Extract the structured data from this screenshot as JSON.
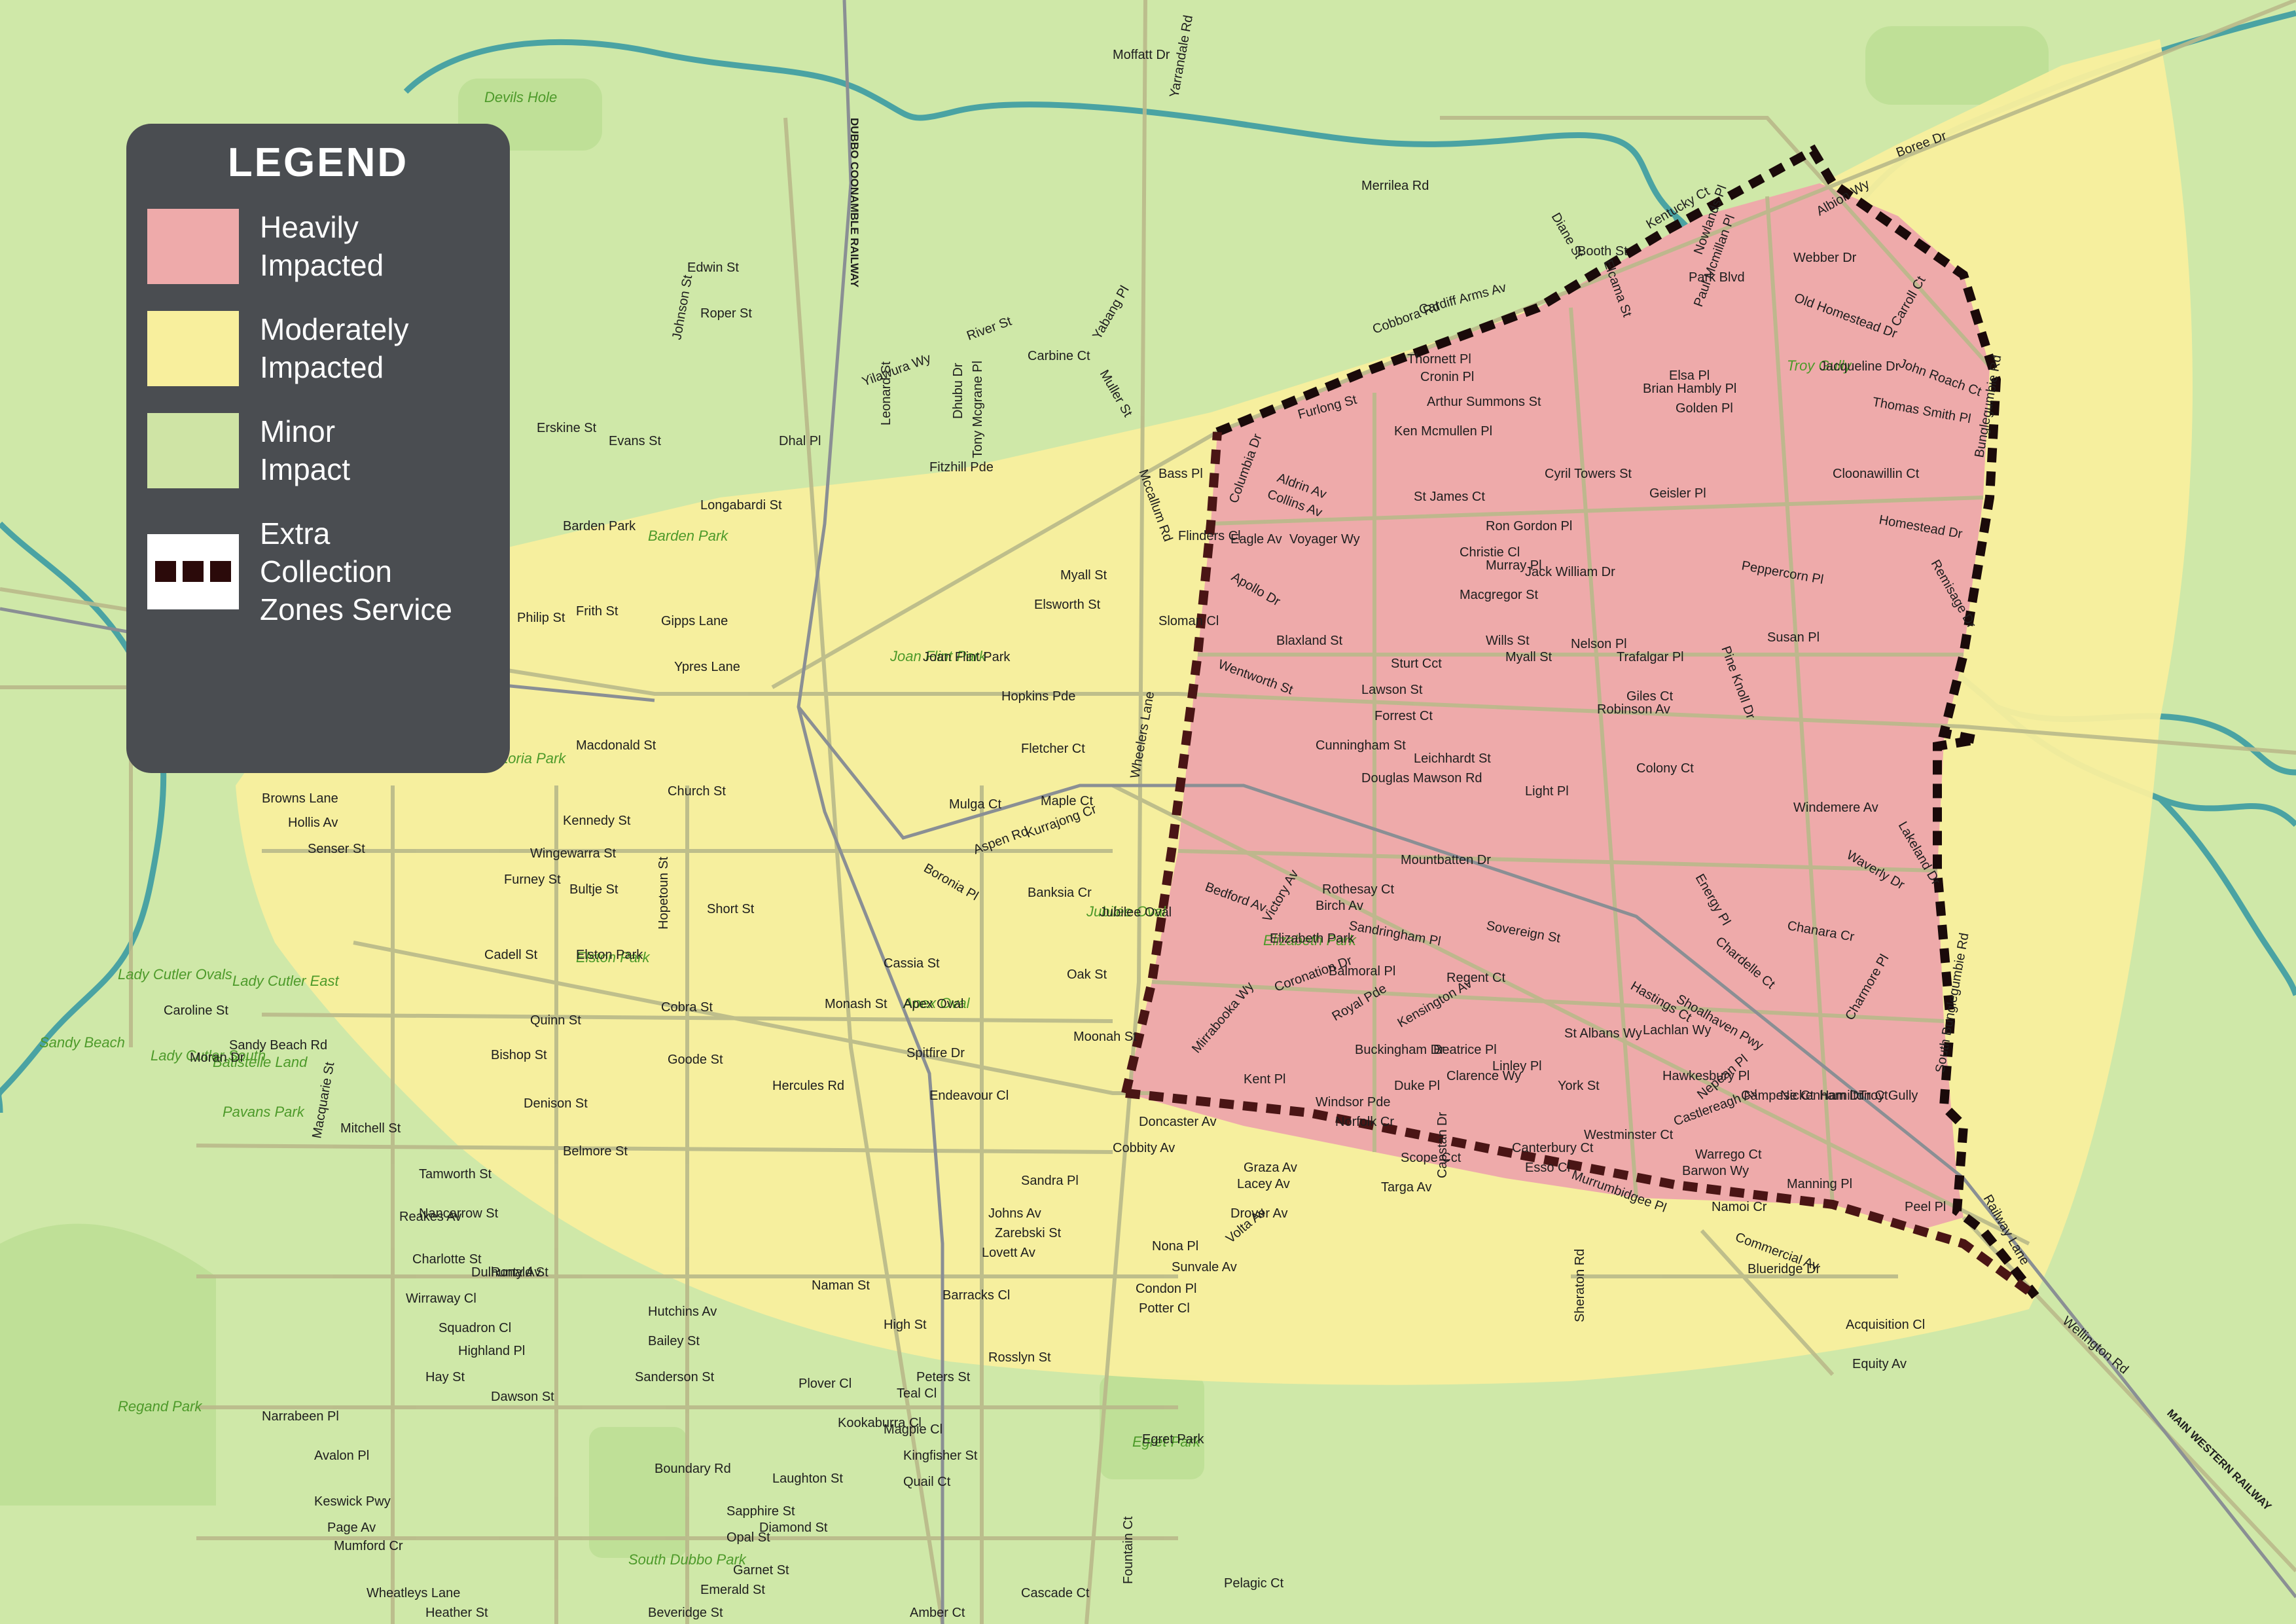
{
  "legend": {
    "title": "LEGEND",
    "items": [
      {
        "label": "Heavily\nImpacted",
        "color": "#eeaaaa"
      },
      {
        "label": "Moderately\nImpacted",
        "color": "#f8ef9d"
      },
      {
        "label": "Minor\nImpact",
        "color": "#cfe4a5"
      },
      {
        "label": "Extra\nCollection\nZones Service",
        "color": "#2b0a0a"
      }
    ]
  },
  "colors": {
    "background": "#cfe8a8",
    "heavy": "#eeaaaa",
    "moderate": "#f8ef9d",
    "minor": "#cfe4a5",
    "boundary": "#1a0a0a",
    "river": "#4aa3a3",
    "roads": "#b9b98a"
  },
  "streets": [
    {
      "text": "Moffatt Dr"
    },
    {
      "text": "Yarrandale Rd"
    },
    {
      "text": "Merrilea Rd"
    },
    {
      "text": "Boree Dr"
    },
    {
      "text": "Kentucky Ct"
    },
    {
      "text": "Albion Wy"
    },
    {
      "text": "Webber Dr"
    },
    {
      "text": "Old Homestead Dr"
    },
    {
      "text": "Carroll Ct"
    },
    {
      "text": "John Roach Ct"
    },
    {
      "text": "Thomas Smith Pl"
    },
    {
      "text": "Bunglegumbie Rd"
    },
    {
      "text": "Cloonawillin Ct"
    },
    {
      "text": "Homestead Dr"
    },
    {
      "text": "Remisage Dr"
    },
    {
      "text": "Peppercorn Pl"
    },
    {
      "text": "Susan Pl"
    },
    {
      "text": "Pine Knoll Dr"
    },
    {
      "text": "Trafalgar Pl"
    },
    {
      "text": "Myall St"
    },
    {
      "text": "Colony Ct"
    },
    {
      "text": "Windemere Av"
    },
    {
      "text": "Waverly Dr"
    },
    {
      "text": "Lakeland Dr"
    },
    {
      "text": "Chanara Cr"
    },
    {
      "text": "Chardelle Ct"
    },
    {
      "text": "Charmore Pl"
    },
    {
      "text": "South Bunglegumbie Rd"
    },
    {
      "text": "Cobbora Rd"
    },
    {
      "text": "Cardiff Arms Av"
    },
    {
      "text": "Thornett Pl"
    },
    {
      "text": "Cronin Pl"
    },
    {
      "text": "Arthur Summons St"
    },
    {
      "text": "Ken Mcmullen Pl"
    },
    {
      "text": "Furlong St"
    },
    {
      "text": "Aldrin Av"
    },
    {
      "text": "Collins Av"
    },
    {
      "text": "Columbia Dr"
    },
    {
      "text": "Voyager Wy"
    },
    {
      "text": "Eagle Av"
    },
    {
      "text": "Apollo Dr"
    },
    {
      "text": "St James Ct"
    },
    {
      "text": "Ron Gordon Pl"
    },
    {
      "text": "Macgregor St"
    },
    {
      "text": "Wills St"
    },
    {
      "text": "Nelson Pl"
    },
    {
      "text": "Blaxland St"
    },
    {
      "text": "Sturt Cct"
    },
    {
      "text": "Wentworth St"
    },
    {
      "text": "Lawson St"
    },
    {
      "text": "Forrest Ct"
    },
    {
      "text": "Cunningham St"
    },
    {
      "text": "Leichhardt St"
    },
    {
      "text": "Giles Ct"
    },
    {
      "text": "Robinson Av"
    },
    {
      "text": "Douglas Mawson Rd"
    },
    {
      "text": "Light Pl"
    },
    {
      "text": "Mountbatten Dr"
    },
    {
      "text": "Bedford Av"
    },
    {
      "text": "Victory Av"
    },
    {
      "text": "Rothesay Ct"
    },
    {
      "text": "Birch Av"
    },
    {
      "text": "Sandringham Pl"
    },
    {
      "text": "Sovereign St"
    },
    {
      "text": "Balmoral Pl"
    },
    {
      "text": "Regent Ct"
    },
    {
      "text": "Coronation Dr"
    },
    {
      "text": "Royal Pde"
    },
    {
      "text": "Buckingham Dr"
    },
    {
      "text": "Kensington Av"
    },
    {
      "text": "Windsor Pde"
    },
    {
      "text": "Duke Pl"
    },
    {
      "text": "Clarence Wy"
    },
    {
      "text": "St Albans Wy"
    },
    {
      "text": "Linley Pl"
    },
    {
      "text": "York St"
    },
    {
      "text": "Hastings Ct"
    },
    {
      "text": "Lachlan Wy"
    },
    {
      "text": "Hawkesbury Pl"
    },
    {
      "text": "Nepean Pl"
    },
    {
      "text": "Castlereagh Av"
    },
    {
      "text": "Warrego Ct"
    },
    {
      "text": "Barwon Wy"
    },
    {
      "text": "Westminster Ct"
    },
    {
      "text": "Murrumbidgee Pl"
    },
    {
      "text": "Namoi Cr"
    },
    {
      "text": "Manning Pl"
    },
    {
      "text": "Peel Pl"
    },
    {
      "text": "Canterbury Ct"
    },
    {
      "text": "Kent Pl"
    },
    {
      "text": "Norfolk Cr"
    },
    {
      "text": "Beatrice Pl"
    },
    {
      "text": "Mirrabooka Wy"
    },
    {
      "text": "Elizabeth Park"
    },
    {
      "text": "Energy Pl"
    },
    {
      "text": "Shoalhaven Pwy"
    },
    {
      "text": "Sloman Cl"
    },
    {
      "text": "Bass Pl"
    },
    {
      "text": "Flinders Cl"
    },
    {
      "text": "Wheelers Lane"
    },
    {
      "text": "Jubilee Oval"
    },
    {
      "text": "Oak St"
    },
    {
      "text": "Moonah St"
    },
    {
      "text": "Spitfire Dr"
    },
    {
      "text": "Endeavour Cl"
    },
    {
      "text": "Hercules Rd"
    },
    {
      "text": "Goode St"
    },
    {
      "text": "Cobra St"
    },
    {
      "text": "Quinn St"
    },
    {
      "text": "Bishop St"
    },
    {
      "text": "Denison St"
    },
    {
      "text": "Belmore St"
    },
    {
      "text": "Macquarie St"
    },
    {
      "text": "Cadell St"
    },
    {
      "text": "Tamworth St"
    },
    {
      "text": "Nancarrow St"
    },
    {
      "text": "Hutchins Av"
    },
    {
      "text": "Bailey St"
    },
    {
      "text": "Sanderson St"
    },
    {
      "text": "Hay St"
    },
    {
      "text": "Dawson St"
    },
    {
      "text": "Narrabeen Pl"
    },
    {
      "text": "Boundary Rd"
    },
    {
      "text": "Laughton St"
    },
    {
      "text": "Sapphire St"
    },
    {
      "text": "Diamond St"
    },
    {
      "text": "Opal St"
    },
    {
      "text": "Garnet St"
    },
    {
      "text": "Emerald St"
    },
    {
      "text": "Heather St"
    },
    {
      "text": "Wheatleys Lane"
    },
    {
      "text": "Beveridge St"
    },
    {
      "text": "Amber Ct"
    },
    {
      "text": "Pelagic Ct"
    },
    {
      "text": "Cascade Ct"
    },
    {
      "text": "Fountain Ct"
    },
    {
      "text": "Egret Park"
    },
    {
      "text": "Commercial Av"
    },
    {
      "text": "Blueridge Dr"
    },
    {
      "text": "Acquisition Cl"
    },
    {
      "text": "Equity Av"
    },
    {
      "text": "Wellington Rd"
    },
    {
      "text": "Sheraton Rd"
    },
    {
      "text": "Railway Lane"
    },
    {
      "text": "Graza Av"
    },
    {
      "text": "Lacey Av"
    },
    {
      "text": "Drover Av"
    },
    {
      "text": "Volta Av"
    },
    {
      "text": "Scope Cct"
    },
    {
      "text": "Targa Av"
    },
    {
      "text": "Capstan Dr"
    },
    {
      "text": "Esso Cl"
    },
    {
      "text": "Mulga Ct"
    },
    {
      "text": "Maple Ct"
    },
    {
      "text": "Kurrajong Cr"
    },
    {
      "text": "Banksia Cr"
    },
    {
      "text": "Boronia Pl"
    },
    {
      "text": "Aspen Rd"
    },
    {
      "text": "Cassia St"
    },
    {
      "text": "Monash St"
    },
    {
      "text": "Apex Oval"
    },
    {
      "text": "Elston Park"
    },
    {
      "text": "Hopetoun St"
    },
    {
      "text": "Short St"
    },
    {
      "text": "Kennedy St"
    },
    {
      "text": "Wingewarra St"
    },
    {
      "text": "Furney St"
    },
    {
      "text": "Bultje St"
    },
    {
      "text": "Macdonald St"
    },
    {
      "text": "Church St"
    },
    {
      "text": "Browns Lane"
    },
    {
      "text": "Hollis Av"
    },
    {
      "text": "Senser St"
    },
    {
      "text": "Joan Flint Park"
    },
    {
      "text": "Fletcher Ct"
    },
    {
      "text": "Hopkins Pde"
    },
    {
      "text": "Elsworth St"
    },
    {
      "text": "Myall St"
    },
    {
      "text": "Fitzhill Pde"
    },
    {
      "text": "Longabardi St"
    },
    {
      "text": "Barden Park"
    },
    {
      "text": "Frith St"
    },
    {
      "text": "Gipps Lane"
    },
    {
      "text": "Ypres Lane"
    },
    {
      "text": "Philip St"
    },
    {
      "text": "Erskine St"
    },
    {
      "text": "Evans St"
    },
    {
      "text": "Edwin St"
    },
    {
      "text": "Roper St"
    },
    {
      "text": "Johnson St"
    },
    {
      "text": "River St"
    },
    {
      "text": "Carbine Ct"
    },
    {
      "text": "Yilawura Wy"
    },
    {
      "text": "Dhal Pl"
    },
    {
      "text": "Yabang Pl"
    },
    {
      "text": "Muller St"
    },
    {
      "text": "Mccallum Rd"
    },
    {
      "text": "Dhubu Dr"
    },
    {
      "text": "Tony Mcgrane Pl"
    },
    {
      "text": "Leonard St"
    },
    {
      "text": "Caroline St"
    },
    {
      "text": "Moran Dr"
    },
    {
      "text": "Sandy Beach Rd"
    },
    {
      "text": "Mitchell St"
    },
    {
      "text": "Reakes Av"
    },
    {
      "text": "Charlotte St"
    },
    {
      "text": "Dulhunty Av"
    },
    {
      "text": "Wirraway Cl"
    },
    {
      "text": "Squadron Cl"
    },
    {
      "text": "Highland Pl"
    },
    {
      "text": "Ronald St"
    },
    {
      "text": "Naman St"
    },
    {
      "text": "Barracks Cl"
    },
    {
      "text": "High St"
    },
    {
      "text": "Rosslyn St"
    },
    {
      "text": "Peters St"
    },
    {
      "text": "Magpie Cl"
    },
    {
      "text": "Kingfisher St"
    },
    {
      "text": "Quail Ct"
    },
    {
      "text": "Kookaburra Cl"
    },
    {
      "text": "Plover Cl"
    },
    {
      "text": "Teal Cl"
    },
    {
      "text": "Zarebski St"
    },
    {
      "text": "Lovett Av"
    },
    {
      "text": "Johns Av"
    },
    {
      "text": "Sandra Pl"
    },
    {
      "text": "Condon Pl"
    },
    {
      "text": "Potter Cl"
    },
    {
      "text": "Nona Pl"
    },
    {
      "text": "Sunvale Av"
    },
    {
      "text": "Cobbity Av"
    },
    {
      "text": "Doncaster Av"
    },
    {
      "text": "Keswick Pwy"
    },
    {
      "text": "Page Av"
    },
    {
      "text": "Mumford Cr"
    },
    {
      "text": "Avalon Pl"
    },
    {
      "text": "Diane St"
    },
    {
      "text": "Booth St"
    },
    {
      "text": "Elcama St"
    },
    {
      "text": "Park Blvd"
    },
    {
      "text": "Paul Mcmillan Pl"
    },
    {
      "text": "Nowlands Pl"
    },
    {
      "text": "Elsa Pl"
    },
    {
      "text": "Brian Hambly Pl"
    },
    {
      "text": "Golden Pl"
    },
    {
      "text": "Geisler Pl"
    },
    {
      "text": "Cyril Towers St"
    },
    {
      "text": "Jack William Dr"
    },
    {
      "text": "Christie Cl"
    },
    {
      "text": "Murray Pl"
    },
    {
      "text": "Jacqueline Dr"
    },
    {
      "text": "Campese Ct"
    },
    {
      "text": "Nickenham Dr"
    },
    {
      "text": "Hamilton Ct"
    },
    {
      "text": "Troy Gully"
    }
  ],
  "places": [
    {
      "text": "Devils Hole"
    },
    {
      "text": "Barden Park"
    },
    {
      "text": "Joan Flint Park"
    },
    {
      "text": "Elston Park"
    },
    {
      "text": "Jubilee Oval"
    },
    {
      "text": "Apex Oval"
    },
    {
      "text": "Elizabeth Park"
    },
    {
      "text": "Troy Gully"
    },
    {
      "text": "Lady Cutler Ovals"
    },
    {
      "text": "Lady Cutler East"
    },
    {
      "text": "Lady Cutler South"
    },
    {
      "text": "Sandy Beach"
    },
    {
      "text": "Batistelle Land"
    },
    {
      "text": "Pavans Park"
    },
    {
      "text": "Regand Park"
    },
    {
      "text": "South Dubbo Park"
    },
    {
      "text": "Egret Park"
    },
    {
      "text": "Victoria Park"
    }
  ],
  "railways": [
    {
      "text": "DUBBO COONAMBLE RAILWAY"
    },
    {
      "text": "MAIN WESTERN RAILWAY"
    }
  ]
}
